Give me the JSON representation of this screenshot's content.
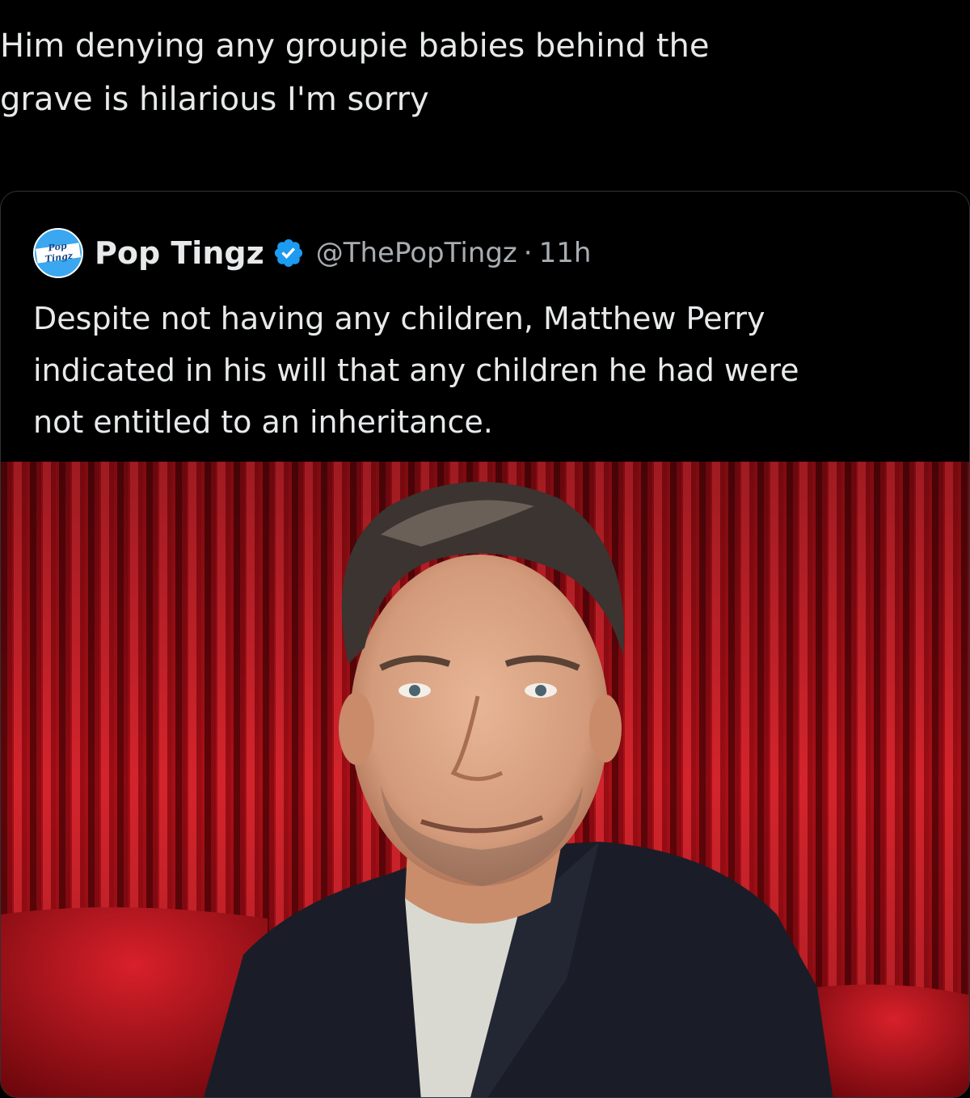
{
  "post": {
    "text_lines": [
      "Him denying any groupie babies behind the",
      "grave is hilarious I'm sorry"
    ]
  },
  "quoted_post": {
    "avatar_text_line1": "Pop",
    "avatar_text_line2": "Tingz",
    "display_name": "Pop Tingz",
    "handle": "@ThePopTingz",
    "separator": "·",
    "time": "11h",
    "text_lines": [
      "Despite not having any children, Matthew Perry",
      "indicated in his will that any children he had were",
      "not entitled to an inheritance."
    ],
    "verified_icon": "verified-badge-icon",
    "verified_color": "#1d9bf0"
  },
  "colors": {
    "background": "#000000",
    "text": "#e7e9ea",
    "secondary_text": "#a8adb2",
    "curtain_red": "#b3121a"
  }
}
